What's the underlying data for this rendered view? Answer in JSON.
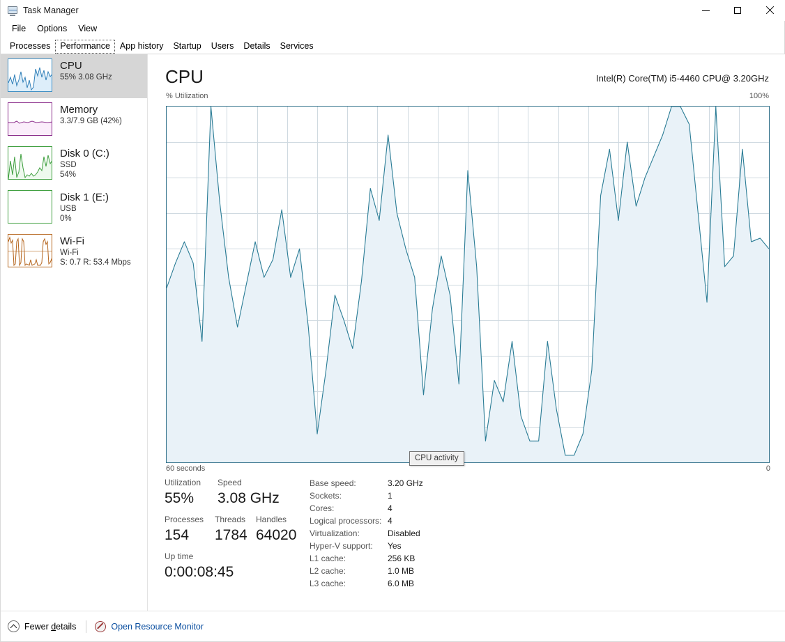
{
  "window": {
    "title": "Task Manager",
    "icon": "task-manager-icon",
    "minimize": "–",
    "maximize": "□",
    "close": "✕"
  },
  "menu": {
    "items": [
      "File",
      "Options",
      "View"
    ]
  },
  "tabs": {
    "items": [
      "Processes",
      "Performance",
      "App history",
      "Startup",
      "Users",
      "Details",
      "Services"
    ],
    "selected": "Performance"
  },
  "sidebar": {
    "items": [
      {
        "title": "CPU",
        "sub1": "55%  3.08 GHz",
        "sub2": "",
        "color": "#3f8fc4",
        "fill": "#e8f2fa",
        "selected": true
      },
      {
        "title": "Memory",
        "sub1": "3.3/7.9 GB (42%)",
        "sub2": "",
        "color": "#8b2d8b",
        "fill": "#fbeefb",
        "selected": false
      },
      {
        "title": "Disk 0 (C:)",
        "sub1": "SSD",
        "sub2": "54%",
        "color": "#3f9f3f",
        "fill": "#eef9ee",
        "selected": false
      },
      {
        "title": "Disk 1 (E:)",
        "sub1": "USB",
        "sub2": "0%",
        "color": "#3f9f3f",
        "fill": "#ffffff",
        "selected": false
      },
      {
        "title": "Wi-Fi",
        "sub1": "Wi-Fi",
        "sub2": "S: 0.7 R: 53.4 Mbps",
        "color": "#b5651d",
        "fill": "#fdf6ef",
        "selected": false
      }
    ]
  },
  "main": {
    "heading": "CPU",
    "model": "Intel(R) Core(TM) i5-4460 CPU@ 3.20GHz",
    "axis_top_left": "% Utilization",
    "axis_top_right": "100%",
    "axis_bottom_left": "60 seconds",
    "axis_bottom_right": "0",
    "tooltip": "CPU activity"
  },
  "stats": {
    "utilization_label": "Utilization",
    "utilization_value": "55%",
    "speed_label": "Speed",
    "speed_value": "3.08 GHz",
    "processes_label": "Processes",
    "processes_value": "154",
    "threads_label": "Threads",
    "threads_value": "1784",
    "handles_label": "Handles",
    "handles_value": "64020",
    "uptime_label": "Up time",
    "uptime_value": "0:00:08:45"
  },
  "specs": [
    {
      "key": "Base speed:",
      "value": "3.20 GHz"
    },
    {
      "key": "Sockets:",
      "value": "1"
    },
    {
      "key": "Cores:",
      "value": "4"
    },
    {
      "key": "Logical processors:",
      "value": "4"
    },
    {
      "key": "Virtualization:",
      "value": "Disabled"
    },
    {
      "key": "Hyper-V support:",
      "value": "Yes"
    },
    {
      "key": "L1 cache:",
      "value": "256 KB"
    },
    {
      "key": "L2 cache:",
      "value": "1.0 MB"
    },
    {
      "key": "L3 cache:",
      "value": "6.0 MB"
    }
  ],
  "footer": {
    "fewer_details": "Fewer details",
    "resource_monitor": "Open Resource Monitor"
  },
  "colors": {
    "graph_line": "#2a7c95",
    "graph_fill": "#e9f2f8",
    "graph_border": "#30708a",
    "grid": "#cfd9e0",
    "link": "#0b4fa0",
    "selection": "#d6d6d6"
  },
  "chart_data": {
    "type": "area",
    "title": "CPU activity",
    "xlabel": "60 seconds",
    "ylabel": "% Utilization",
    "ylim": [
      0,
      100
    ],
    "xlim": [
      60,
      0
    ],
    "grid": true,
    "grid_cols": 20,
    "grid_rows": 10,
    "series": [
      {
        "name": "CPU Utilization",
        "values": [
          49,
          56,
          62,
          56,
          34,
          100,
          73,
          52,
          38,
          50,
          62,
          52,
          57,
          71,
          52,
          60,
          38,
          8,
          26,
          47,
          40,
          32,
          51,
          77,
          68,
          92,
          70,
          60,
          52,
          19,
          43,
          58,
          47,
          22,
          82,
          55,
          6,
          23,
          17,
          34,
          13,
          6,
          6,
          34,
          15,
          2,
          2,
          8,
          26,
          75,
          88,
          68,
          90,
          72,
          80,
          86,
          92,
          100,
          100,
          95,
          70,
          45,
          100,
          55,
          58,
          88,
          62,
          63,
          60
        ]
      }
    ]
  }
}
